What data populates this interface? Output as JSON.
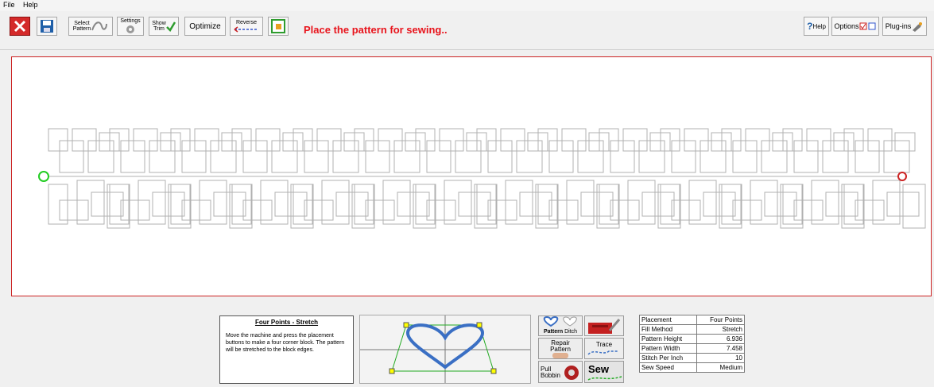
{
  "menu": [
    "File",
    "Help"
  ],
  "toolbar": {
    "select_pattern": [
      "Select",
      "Pattern"
    ],
    "settings": "Settings",
    "show_trim": [
      "Show",
      "Trim"
    ],
    "optimize": "Optimize",
    "reverse": "Reverse",
    "status": "Place the pattern for sewing..",
    "help": "Help",
    "options": "Options",
    "plugins": "Plug-ins"
  },
  "info_panel": {
    "title": "Four Points - Stretch",
    "description": "Move the machine and press the placement buttons to make a four corner block. The pattern will be stretched to the block edges."
  },
  "buttons": {
    "pattern": "Pattern",
    "ditch": "Ditch",
    "repair": [
      "Repair",
      "Pattern"
    ],
    "trace": "Trace",
    "pull_bobbin": [
      "Pull",
      "Bobbin"
    ],
    "sew": "Sew"
  },
  "properties": [
    {
      "label": "Placement",
      "value": "Four Points"
    },
    {
      "label": "Fill Method",
      "value": "Stretch"
    },
    {
      "label": "Pattern Height",
      "value": "6.936"
    },
    {
      "label": "Pattern Width",
      "value": "7.458"
    },
    {
      "label": "Stitch Per Inch",
      "value": "10"
    },
    {
      "label": "Sew Speed",
      "value": "Medium"
    }
  ],
  "colors": {
    "status": "#e8141c",
    "start_marker": "#22cc22",
    "end_marker": "#cc2222",
    "workarea_border": "#cc2222"
  }
}
